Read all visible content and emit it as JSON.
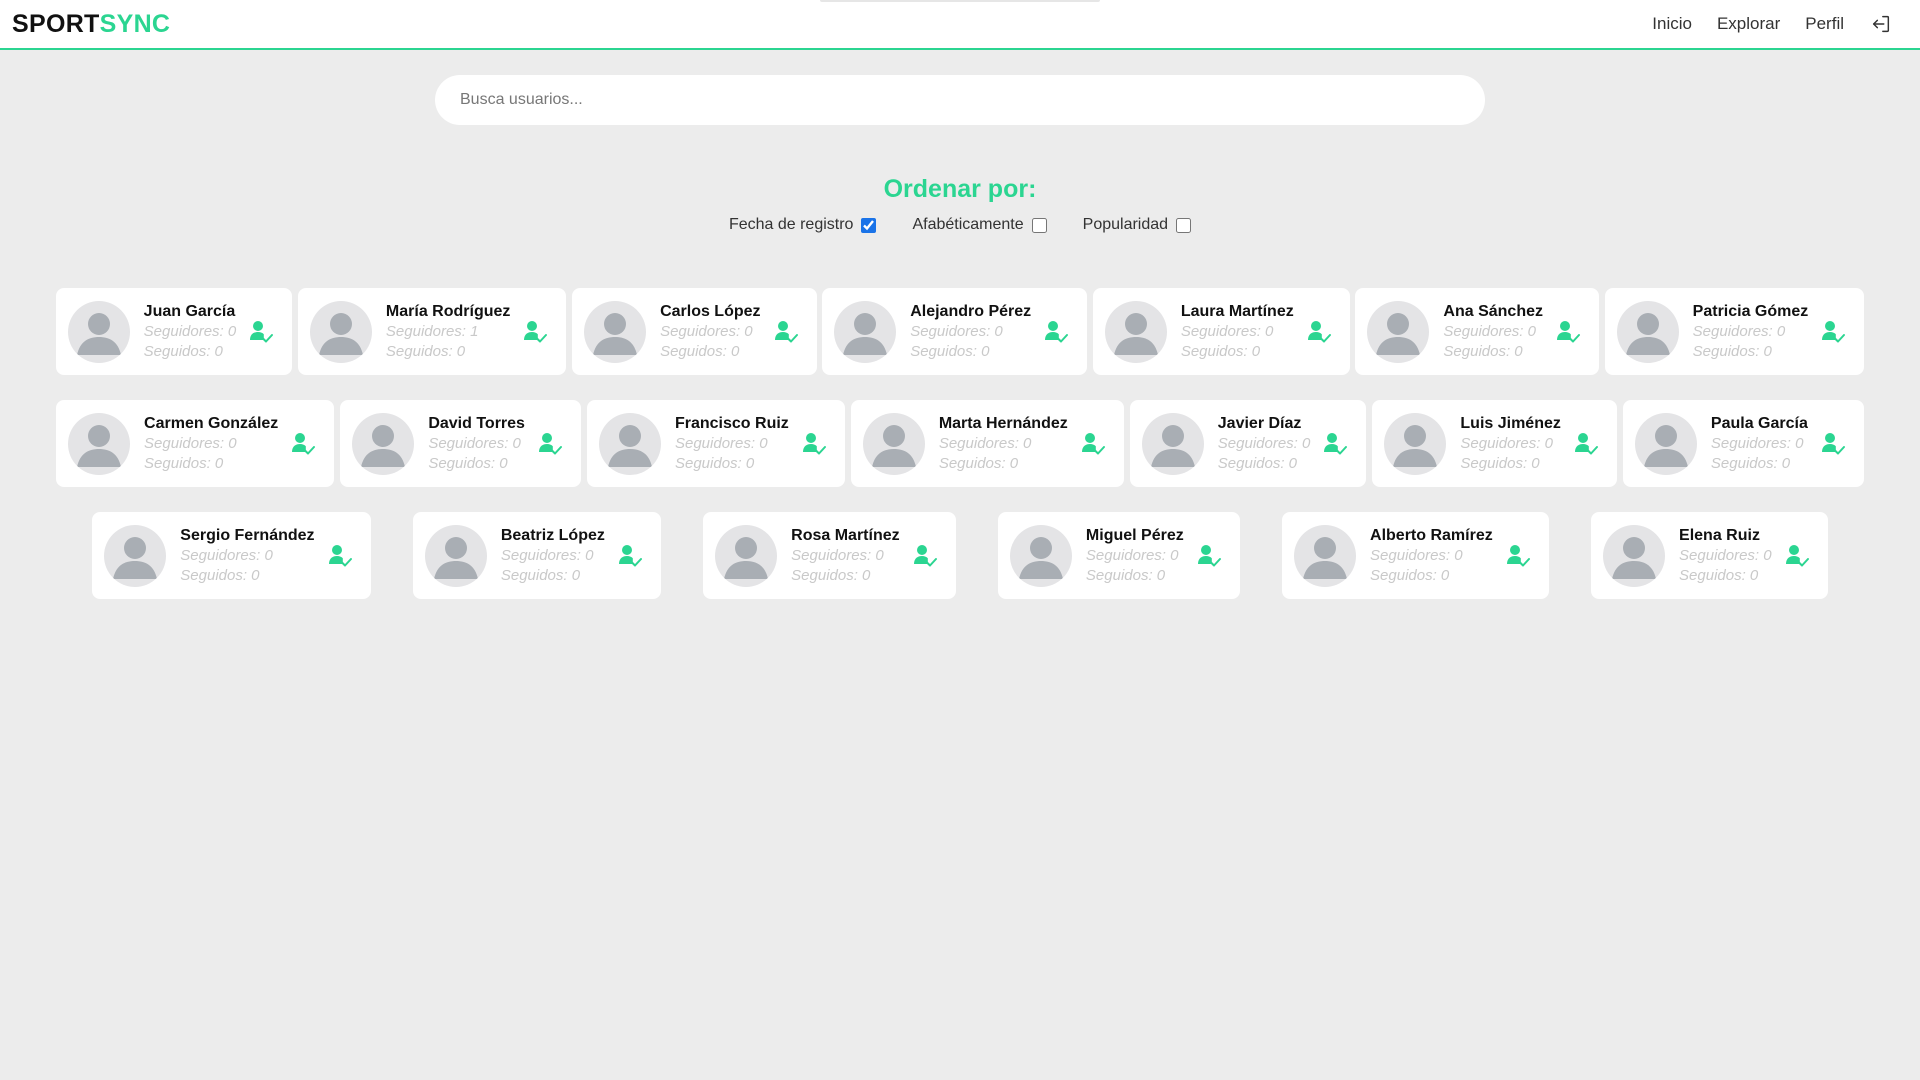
{
  "header": {
    "logo_part1": "SPORT",
    "logo_part2": "SYNC",
    "nav": [
      "Inicio",
      "Explorar",
      "Perfil"
    ],
    "logout_icon": "logout-icon"
  },
  "search": {
    "placeholder": "Busca usuarios..."
  },
  "sort": {
    "title": "Ordenar por:",
    "options": [
      {
        "label": "Fecha de registro",
        "checked": true
      },
      {
        "label": "Afabéticamente",
        "checked": false
      },
      {
        "label": "Popularidad",
        "checked": false
      }
    ]
  },
  "colors": {
    "accent": "#2bd591",
    "background": "#ececec",
    "card": "#ffffff",
    "muted_text": "#c9c9c9"
  },
  "icons": {
    "avatar": "user-avatar-placeholder",
    "follow": "user-check-icon"
  },
  "users": [
    {
      "name": "Juan García",
      "followers": "Seguidores: 0",
      "following": "Seguidos: 0"
    },
    {
      "name": "María Rodríguez",
      "followers": "Seguidores: 1",
      "following": "Seguidos: 0"
    },
    {
      "name": "Carlos López",
      "followers": "Seguidores: 0",
      "following": "Seguidos: 0"
    },
    {
      "name": "Alejandro Pérez",
      "followers": "Seguidores: 0",
      "following": "Seguidos: 0"
    },
    {
      "name": "Laura Martínez",
      "followers": "Seguidores: 0",
      "following": "Seguidos: 0"
    },
    {
      "name": "Ana Sánchez",
      "followers": "Seguidores: 0",
      "following": "Seguidos: 0"
    },
    {
      "name": "Patricia Gómez",
      "followers": "Seguidores: 0",
      "following": "Seguidos: 0"
    },
    {
      "name": "Carmen González",
      "followers": "Seguidores: 0",
      "following": "Seguidos: 0"
    },
    {
      "name": "David Torres",
      "followers": "Seguidores: 0",
      "following": "Seguidos: 0"
    },
    {
      "name": "Francisco Ruiz",
      "followers": "Seguidores: 0",
      "following": "Seguidos: 0"
    },
    {
      "name": "Marta Hernández",
      "followers": "Seguidores: 0",
      "following": "Seguidos: 0"
    },
    {
      "name": "Javier Díaz",
      "followers": "Seguidores: 0",
      "following": "Seguidos: 0"
    },
    {
      "name": "Luis Jiménez",
      "followers": "Seguidores: 0",
      "following": "Seguidos: 0"
    },
    {
      "name": "Paula García",
      "followers": "Seguidores: 0",
      "following": "Seguidos: 0"
    },
    {
      "name": "Sergio Fernández",
      "followers": "Seguidores: 0",
      "following": "Seguidos: 0"
    },
    {
      "name": "Beatriz López",
      "followers": "Seguidores: 0",
      "following": "Seguidos: 0"
    },
    {
      "name": "Rosa Martínez",
      "followers": "Seguidores: 0",
      "following": "Seguidos: 0"
    },
    {
      "name": "Miguel Pérez",
      "followers": "Seguidores: 0",
      "following": "Seguidos: 0"
    },
    {
      "name": "Alberto Ramírez",
      "followers": "Seguidores: 0",
      "following": "Seguidos: 0"
    },
    {
      "name": "Elena Ruiz",
      "followers": "Seguidores: 0",
      "following": "Seguidos: 0"
    }
  ]
}
